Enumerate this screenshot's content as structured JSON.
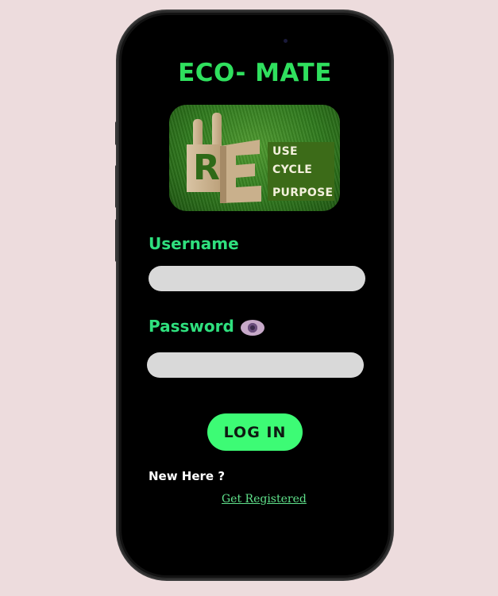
{
  "app": {
    "title": "ECO- MATE"
  },
  "banner": {
    "words": [
      "USE",
      "CYCLE",
      "PURPOSE"
    ],
    "letters": [
      "R",
      "E"
    ]
  },
  "form": {
    "username_label": "Username",
    "username_value": "",
    "password_label": "Password",
    "password_value": "",
    "eye_icon": "eye-icon"
  },
  "actions": {
    "login_label": "LOG IN",
    "new_here": "New Here ?",
    "register_link": "Get Registered"
  },
  "colors": {
    "page_background": "#eddcdd",
    "screen_background": "#000000",
    "title_green": "#2fe05e",
    "label_green": "#2fe07e",
    "button_green": "#3dfb75",
    "input_gray": "#d9d9d9",
    "link_green": "#5fe08a"
  }
}
